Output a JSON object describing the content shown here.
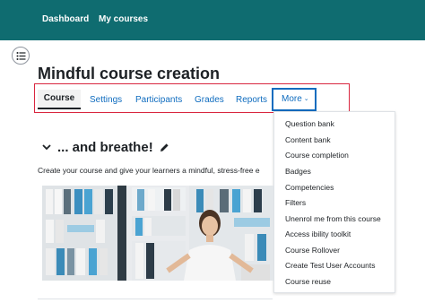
{
  "topnav": {
    "dashboard": "Dashboard",
    "mycourses": "My courses"
  },
  "page": {
    "title": "Mindful course creation"
  },
  "secnav": {
    "course": "Course",
    "settings": "Settings",
    "participants": "Participants",
    "grades": "Grades",
    "reports": "Reports",
    "more": "More"
  },
  "more_menu": [
    "Question bank",
    "Content bank",
    "Course completion",
    "Badges",
    "Competencies",
    "Filters",
    "Unenrol me from this course",
    "Access ibility toolkit",
    "Course Rollover",
    "Create Test User Accounts",
    "Course reuse"
  ],
  "section": {
    "title": "... and breathe!",
    "summary": "Create your course and give your learners a mindful, stress-free e"
  },
  "icons": {
    "drawer": "list-icon",
    "collapse": "chevron-down-icon",
    "edit": "pencil-icon",
    "more": "chevron-down-icon"
  },
  "colors": {
    "topbar": "#0f6c70",
    "link": "#0f6cbf",
    "highlight_red": "#d9263f"
  }
}
